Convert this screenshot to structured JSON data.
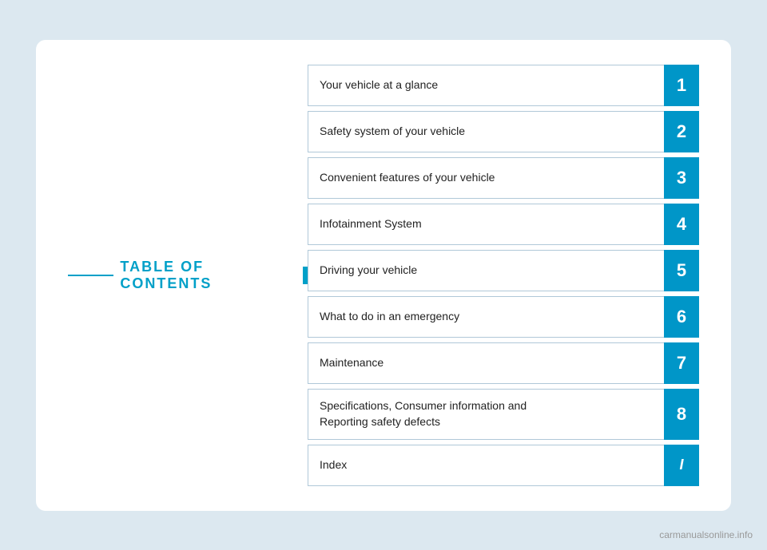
{
  "page": {
    "background_color": "#dce8f0",
    "card_color": "#ffffff"
  },
  "toc": {
    "title": "TABLE OF CONTENTS",
    "accent_color": "#00a0c8",
    "items": [
      {
        "id": "item-1",
        "label": "Your vehicle at a glance",
        "number": "1",
        "tall": false
      },
      {
        "id": "item-2",
        "label": "Safety system of your vehicle",
        "number": "2",
        "tall": false
      },
      {
        "id": "item-3",
        "label": "Convenient features of your vehicle",
        "number": "3",
        "tall": false
      },
      {
        "id": "item-4",
        "label": "Infotainment System",
        "number": "4",
        "tall": false
      },
      {
        "id": "item-5",
        "label": "Driving your vehicle",
        "number": "5",
        "tall": false
      },
      {
        "id": "item-6",
        "label": "What to do in an emergency",
        "number": "6",
        "tall": false
      },
      {
        "id": "item-7",
        "label": "Maintenance",
        "number": "7",
        "tall": false
      },
      {
        "id": "item-8",
        "label": "Specifications, Consumer information and\nReporting safety defects",
        "number": "8",
        "tall": true
      },
      {
        "id": "item-i",
        "label": "Index",
        "number": "I",
        "tall": false,
        "index": true
      }
    ]
  },
  "watermark": {
    "text": "carmanualsonline.info"
  }
}
